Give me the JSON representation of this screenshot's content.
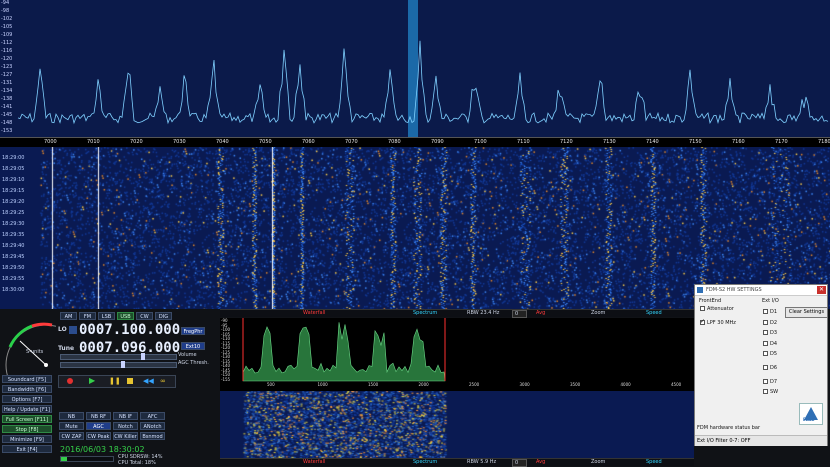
{
  "spectrum": {
    "db_labels": [
      "-94",
      "-98",
      "-102",
      "-105",
      "-109",
      "-112",
      "-116",
      "-120",
      "-123",
      "-127",
      "-131",
      "-134",
      "-138",
      "-141",
      "-145",
      "-148",
      "-153"
    ],
    "freq_labels": [
      "7000",
      "7010",
      "7020",
      "7030",
      "7040",
      "7050",
      "7060",
      "7070",
      "7080",
      "7090",
      "7100",
      "7110",
      "7120",
      "7130",
      "7140",
      "7150",
      "7160",
      "7170",
      "7180"
    ]
  },
  "waterfall": {
    "timestamps": [
      "18:29:00",
      "18:29:05",
      "18:29:10",
      "18:29:15",
      "18:29:20",
      "18:29:25",
      "18:29:30",
      "18:29:35",
      "18:29:40",
      "18:29:45",
      "18:29:50",
      "18:29:55",
      "18:30:00"
    ]
  },
  "controls": {
    "lo_label": "LO",
    "lo_freq": "0007.100.000",
    "tune_label": "Tune",
    "tune_freq": "0007.096.000",
    "volume_label": "Volume",
    "agc_label": "AGC Thresh.",
    "fregphr": "FregPhr",
    "ext10": "Ext10",
    "mode_buttons": [
      "AM",
      "FM",
      "LSB",
      "USB",
      "CW",
      "DIG"
    ],
    "lsb_label": "LSB",
    "side_buttons": [
      "Soundcard [F5]",
      "Bandwidth [F6]",
      "Options [F7]",
      "Help / Update [F1]",
      "Full Screen [F11]",
      "Stop [F8]",
      "Minimize [F9]",
      "Exit [F4]"
    ],
    "dsp_row1": [
      "NB",
      "NB RF",
      "NB IF",
      "AFC"
    ],
    "dsp_row2": [
      "Mute",
      "AGC Slow",
      "Notch",
      "ANotch"
    ],
    "dsp_row3": [
      "CW ZAP",
      "CW Peak",
      "CW Killer",
      "Bsnmod"
    ],
    "datetime": "2016/06/03 18:30:02",
    "cpu_sdr": "CPU SDRSW: 14%",
    "cpu_total": "CPU Total: 18%",
    "meter_label": "S-units"
  },
  "mini_spectrum": {
    "db_labels": [
      "-90",
      "-95",
      "-100",
      "-105",
      "-110",
      "-115",
      "-120",
      "-125",
      "-130",
      "-135",
      "-140",
      "-145",
      "-150",
      "-155"
    ],
    "freq_labels": [
      "500",
      "1000",
      "1500",
      "2000",
      "2500",
      "3000",
      "3500",
      "4000",
      "4500"
    ]
  },
  "ctrlbar_top": {
    "waterfall": "Waterfall",
    "spectrum": "Spectrum",
    "rbw": "RBW 23.4 Hz",
    "rbw_val": "0",
    "avg": "Avg",
    "zoom": "Zoom",
    "speed": "Speed"
  },
  "ctrlbar_bottom": {
    "waterfall": "Waterfall",
    "spectrum": "Spectrum",
    "rbw": "RBW 5.9 Hz",
    "rbw_val": "0",
    "avg": "Avg",
    "zoom": "Zoom",
    "speed": "Speed"
  },
  "dialog": {
    "title": "FDM-S2 HW SETTINGS",
    "frontend_label": "FrontEnd",
    "attenuator": "Attenuator",
    "lpf": "LPF 30 MHz",
    "extio_label": "Ext I/O",
    "d_items": [
      "D1",
      "D2",
      "D3",
      "D4",
      "D5",
      "D6",
      "D7",
      "SW"
    ],
    "clear_btn": "Clear Settings",
    "status_label": "FDM hardware status bar",
    "status_text": "Ext I/O Filter 0-7: OFF",
    "logo": "ELAD"
  },
  "colors": {
    "spectrum_bg": "#0b1a4a",
    "trace": "#7fd0ff",
    "marker": "#1e78b8",
    "accent_red": "#ff3b3b",
    "accent_cyan": "#33d6ff"
  }
}
